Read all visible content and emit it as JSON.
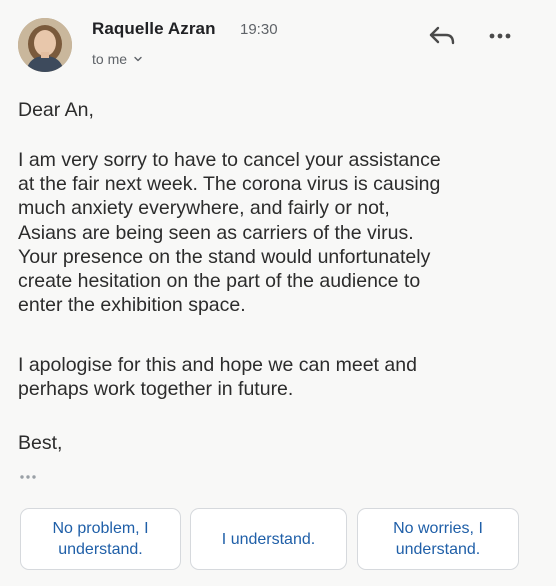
{
  "header": {
    "sender_name": "Raquelle Azran",
    "time": "19:30",
    "recipient": "to me",
    "avatar_icon": "person-photo-avatar",
    "reply_icon": "reply-arrow-icon",
    "more_icon": "more-dots-icon",
    "chevron_icon": "chevron-down-icon"
  },
  "body": {
    "greeting": "Dear An,",
    "paragraph_1": "I am very sorry to have to cancel your assistance\nat the fair next week. The corona virus is causing\nmuch anxiety everywhere, and fairly or not,\nAsians are being seen as carriers of the virus.\nYour presence on the stand would unfortunately\ncreate hesitation on the part of the audience to\nenter the exhibition space.",
    "paragraph_2": "I apologise for this and hope we can meet and\nperhaps work together in future.",
    "signoff": "Best,",
    "trimmed_content_icon": "ellipsis-icon"
  },
  "smart_replies": [
    {
      "label": "No problem, I\nunderstand."
    },
    {
      "label": "I understand."
    },
    {
      "label": "No worries, I\nunderstand."
    }
  ],
  "colors": {
    "background": "#f8f8f7",
    "text": "#2c2c2c",
    "secondary_text": "#5f6368",
    "chip_text": "#1f5fa8",
    "chip_border": "#d6d9dd"
  }
}
